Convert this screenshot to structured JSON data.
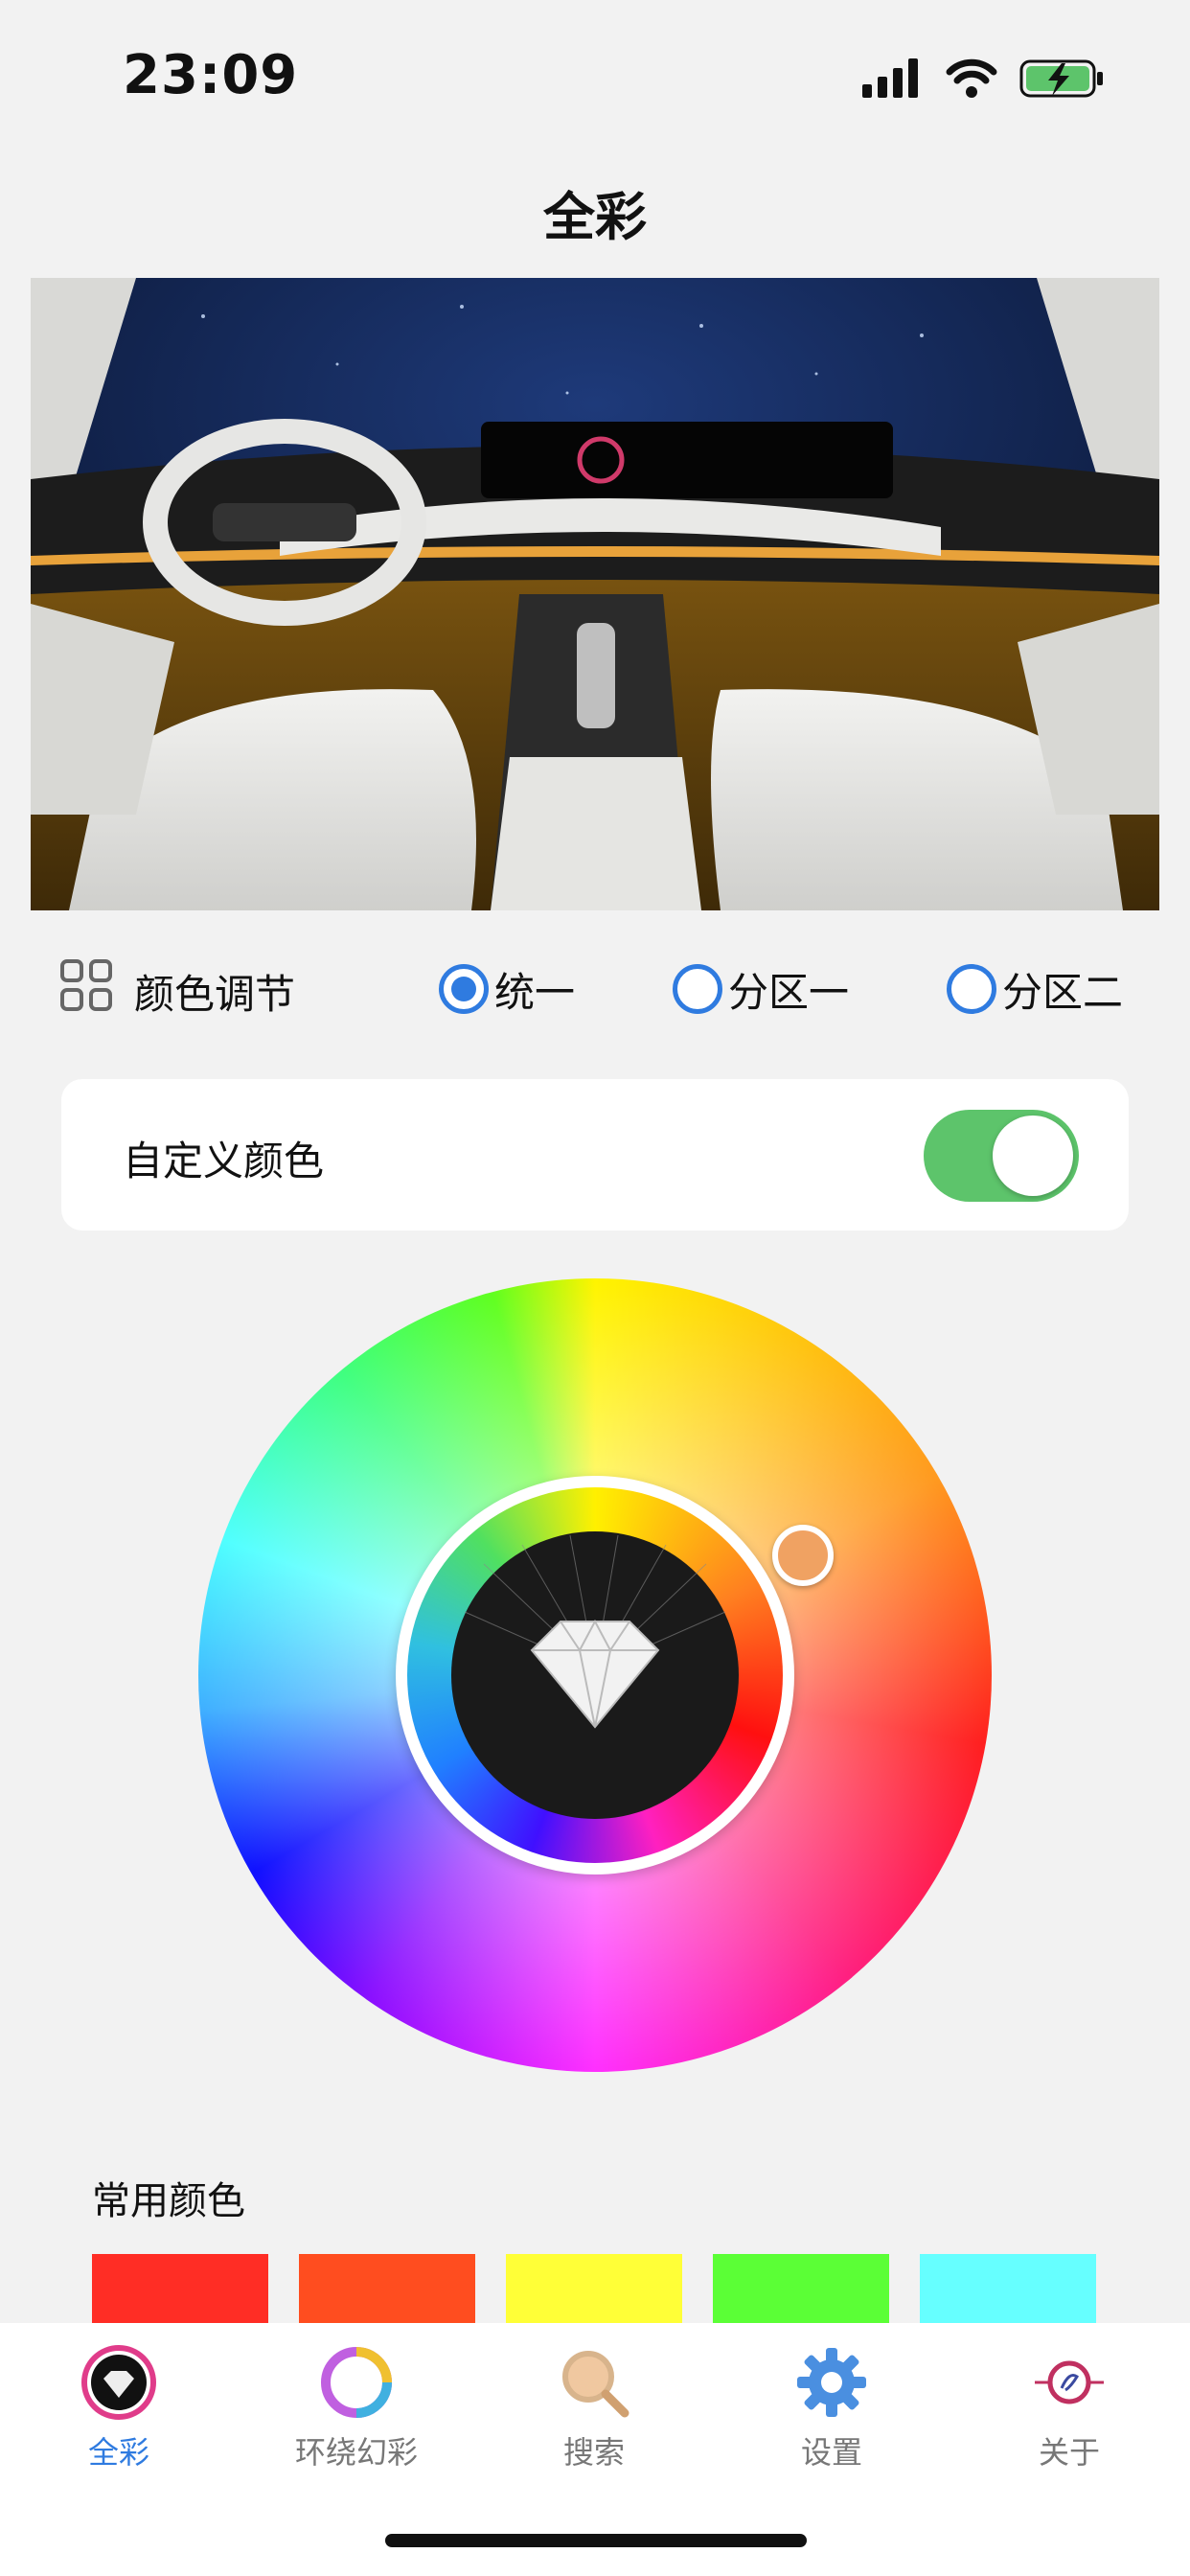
{
  "status_bar": {
    "time": "23:09"
  },
  "header": {
    "title": "全彩"
  },
  "color_adjust": {
    "label": "颜色调节",
    "options": [
      {
        "label": "统一",
        "selected": true
      },
      {
        "label": "分区一",
        "selected": false
      },
      {
        "label": "分区二",
        "selected": false
      }
    ]
  },
  "custom_color": {
    "label": "自定义颜色",
    "enabled": true
  },
  "color_wheel": {
    "selected_color": "#f0a262"
  },
  "common_colors": {
    "label": "常用颜色",
    "swatches": [
      "#ff2d25",
      "#ff4d1f",
      "#ffff37",
      "#5bff36",
      "#66ffff"
    ]
  },
  "tabbar": {
    "tabs": [
      {
        "label": "全彩",
        "active": true,
        "icon": "diamond-icon"
      },
      {
        "label": "环绕幻彩",
        "active": false,
        "icon": "color-ring-icon"
      },
      {
        "label": "搜索",
        "active": false,
        "icon": "magnifier-icon"
      },
      {
        "label": "设置",
        "active": false,
        "icon": "gear-icon"
      },
      {
        "label": "关于",
        "active": false,
        "icon": "logo-icon"
      }
    ]
  },
  "colors": {
    "accent": "#2f7be0",
    "toggle_on": "#5dc46b"
  }
}
